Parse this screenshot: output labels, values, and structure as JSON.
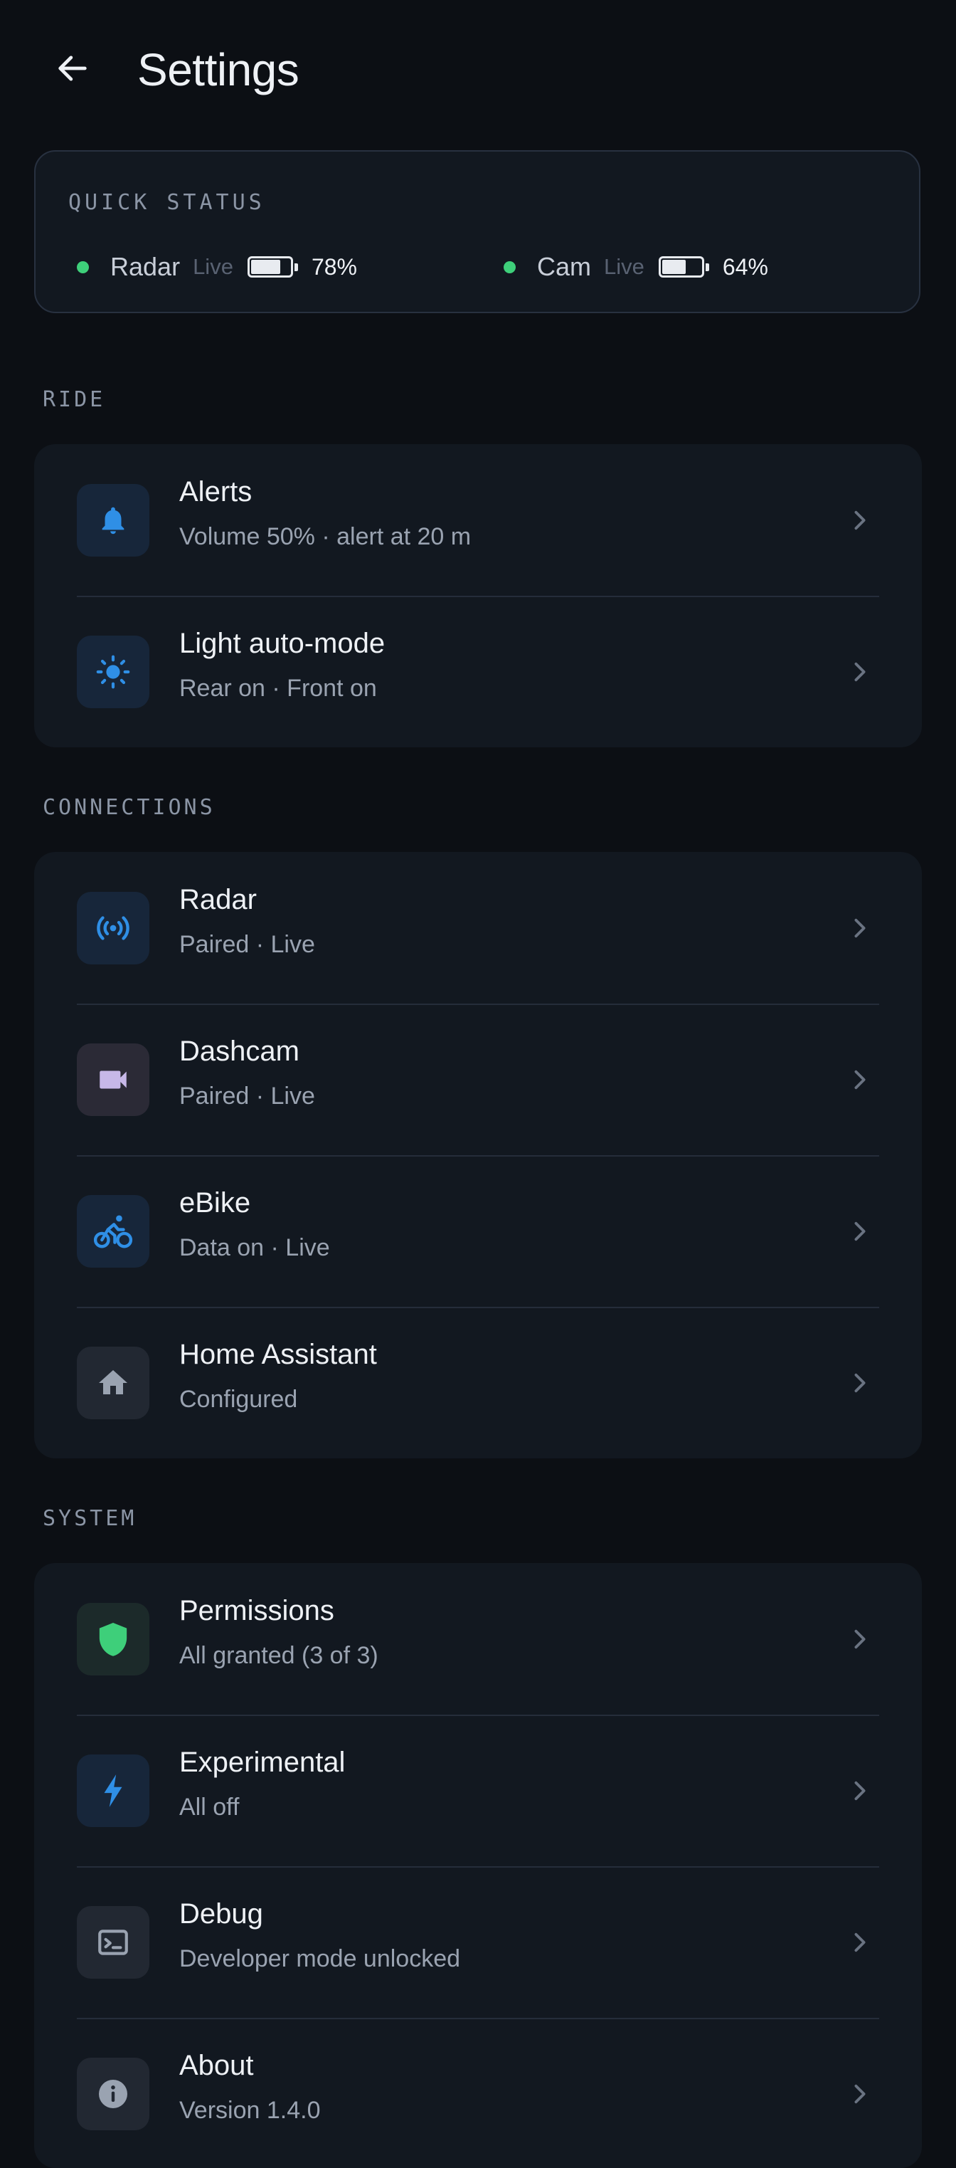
{
  "header": {
    "title": "Settings",
    "back_icon": "arrow-left-icon"
  },
  "quick_status": {
    "title": "QUICK STATUS",
    "status_color": "#3ecf7a",
    "devices": [
      {
        "name": "Radar",
        "state": "Live",
        "battery_pct": "78%",
        "battery_level": 0.78
      },
      {
        "name": "Cam",
        "state": "Live",
        "battery_pct": "64%",
        "battery_level": 0.64
      }
    ]
  },
  "sections": {
    "ride": {
      "title": "RIDE",
      "items": [
        {
          "title": "Alerts",
          "subtitle": "Volume 50% · alert at 20 m",
          "icon": "bell-icon"
        },
        {
          "title": "Light auto-mode",
          "subtitle": "Rear on · Front on",
          "icon": "sun-icon"
        }
      ]
    },
    "connections": {
      "title": "CONNECTIONS",
      "items": [
        {
          "title": "Radar",
          "subtitle": "Paired · Live",
          "icon": "radar-broadcast-icon"
        },
        {
          "title": "Dashcam",
          "subtitle": "Paired · Live",
          "icon": "video-camera-icon"
        },
        {
          "title": "eBike",
          "subtitle": "Data on · Live",
          "icon": "bicycle-rider-icon"
        },
        {
          "title": "Home Assistant",
          "subtitle": "Configured",
          "icon": "home-icon"
        }
      ]
    },
    "system": {
      "title": "SYSTEM",
      "items": [
        {
          "title": "Permissions",
          "subtitle": "All granted (3 of 3)",
          "icon": "shield-icon"
        },
        {
          "title": "Experimental",
          "subtitle": "All off",
          "icon": "lightning-bolt-icon"
        },
        {
          "title": "Debug",
          "subtitle": "Developer mode unlocked",
          "icon": "terminal-icon"
        },
        {
          "title": "About",
          "subtitle": "Version 1.4.0",
          "icon": "info-icon"
        }
      ]
    }
  },
  "colors": {
    "background": "#0c0f14",
    "card": "#121820",
    "accent_blue": "#2f8fe6",
    "success_green": "#3ecf7a",
    "muted_purple": "#c7b8e8"
  }
}
